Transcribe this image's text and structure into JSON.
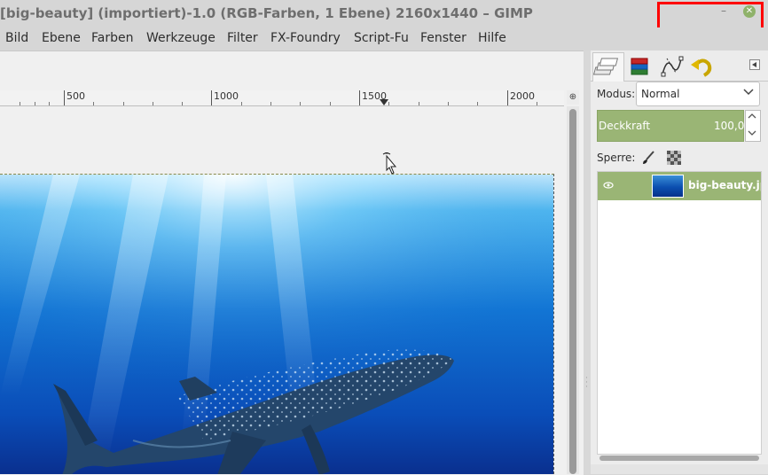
{
  "window": {
    "title": "[big-beauty] (importiert)-1.0 (RGB-Farben, 1 Ebene) 2160x1440 – GIMP",
    "minimize_glyph": "–",
    "close_glyph": "✕"
  },
  "menu": [
    "Bild",
    "Ebene",
    "Farben",
    "Werkzeuge",
    "Filter",
    "FX-Foundry",
    "Script-Fu",
    "Fenster",
    "Hilfe"
  ],
  "ruler": {
    "labels": [
      "500",
      "1000",
      "1500",
      "2000"
    ],
    "zoom_glyph": "⊕"
  },
  "layers_panel": {
    "mode_label": "Modus:",
    "mode_value": "Normal",
    "opacity_label": "Deckkraft",
    "opacity_value": "100,0",
    "lock_label": "Sperre:",
    "layer": {
      "name": "big-beauty.jpg",
      "visible_glyph": "👁"
    }
  },
  "colors": {
    "accent": "#9ab575",
    "highlight_box": "#ff0000",
    "water_top": "#bfe9ff",
    "water_deep": "#0a2f8e"
  },
  "icons": {
    "tabs": [
      "layers-icon",
      "channels-icon",
      "paths-icon",
      "undo-history-icon"
    ],
    "panel_menu": "panel-menu-icon"
  }
}
